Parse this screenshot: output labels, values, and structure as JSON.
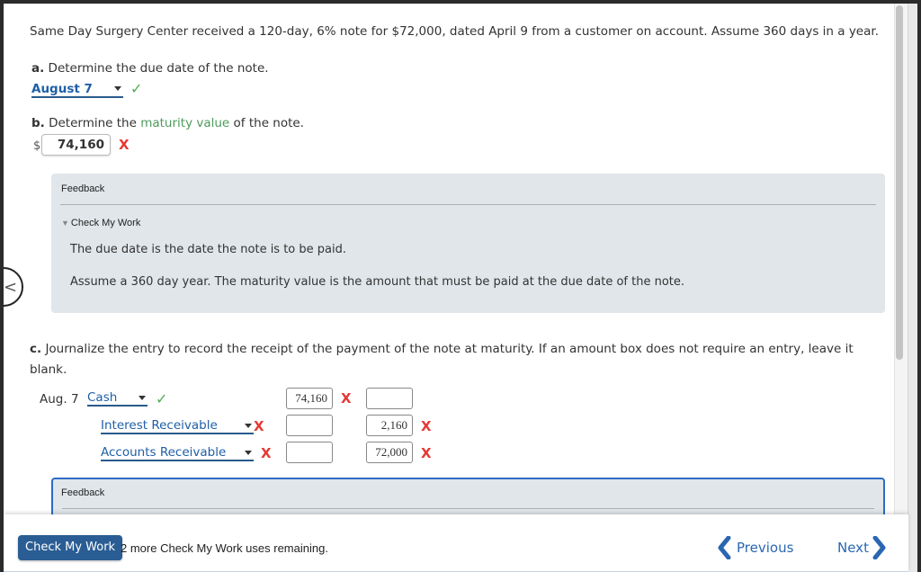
{
  "problem": {
    "intro": "Same Day Surgery Center received a 120-day, 6% note for $72,000, dated April 9 from a customer on account. Assume 360 days in a year."
  },
  "part_a": {
    "letter": "a.",
    "prompt": "Determine the due date of the note.",
    "selected": "August 7",
    "status": "correct",
    "status_glyph": "✓"
  },
  "part_b": {
    "letter": "b.",
    "prompt_before": "Determine the ",
    "prompt_term": "maturity value",
    "prompt_after": " of the note.",
    "currency": "$",
    "value": "74,160",
    "status": "incorrect",
    "status_glyph": "X"
  },
  "feedback_1": {
    "title": "Feedback",
    "toggle_glyph": "▼",
    "toggle_label": "Check My Work",
    "lines": [
      "The due date is the date the note is to be paid.",
      "Assume a 360 day year. The maturity value is the amount that must be paid at the due date of the note."
    ]
  },
  "part_c": {
    "letter": "c.",
    "prompt": "Journalize the entry to record the receipt of the payment of the note at maturity. If an amount box does not require an entry, leave it blank.",
    "date": "Aug. 7",
    "rows": [
      {
        "account": "Cash",
        "account_status": "✓",
        "debit": "74,160",
        "debit_status": "X",
        "credit": "",
        "credit_status": ""
      },
      {
        "account": "Interest Receivable",
        "account_status": "X",
        "debit": "",
        "debit_status": "",
        "credit": "2,160",
        "credit_status": "X"
      },
      {
        "account": "Accounts Receivable",
        "account_status": "X",
        "debit": "",
        "debit_status": "",
        "credit": "72,000",
        "credit_status": "X"
      }
    ]
  },
  "feedback_2": {
    "title": "Feedback"
  },
  "footer": {
    "check_button": "Check My Work",
    "remaining": "2 more Check My Work uses remaining.",
    "previous": "Previous",
    "next": "Next"
  },
  "side_nav": {
    "glyph": "<"
  },
  "colors": {
    "correct": "#4caf50",
    "incorrect": "#e53935",
    "link": "#1f5fa8",
    "button": "#2a5d93",
    "feedback_bg": "#e0e6ea"
  }
}
